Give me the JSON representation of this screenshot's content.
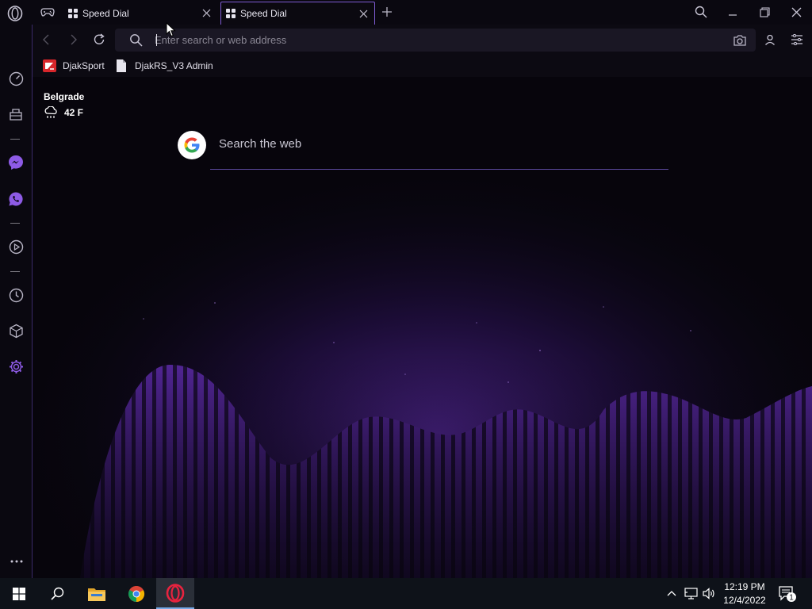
{
  "tabs": [
    {
      "title": "Speed Dial",
      "active": false
    },
    {
      "title": "Speed Dial",
      "active": true
    }
  ],
  "address_bar": {
    "placeholder": "Enter search or web address",
    "value": ""
  },
  "bookmarks": [
    {
      "label": "DjakSport",
      "icon": "djaksport-favicon"
    },
    {
      "label": "DjakRS_V3 Admin",
      "icon": "document-icon"
    }
  ],
  "weather": {
    "city": "Belgrade",
    "temperature": "42 F",
    "icon": "rain-cloud-icon"
  },
  "web_search": {
    "placeholder": "Search the web",
    "engine_icon": "google-icon"
  },
  "sidebar_items": [
    "speed-dial-icon",
    "bag-icon",
    "messenger-icon",
    "whatsapp-icon",
    "player-icon",
    "history-icon",
    "extensions-icon",
    "settings-icon"
  ],
  "taskbar": {
    "apps": [
      "start-icon",
      "search-icon",
      "file-explorer-icon",
      "chrome-icon",
      "opera-icon"
    ],
    "time": "12:19 PM",
    "date": "12/4/2022",
    "notifications": "1"
  },
  "colors": {
    "accent": "#7e5bd1",
    "background": "#08060d",
    "wave": "#8a4fe0",
    "taskbar": "#0e1219"
  }
}
